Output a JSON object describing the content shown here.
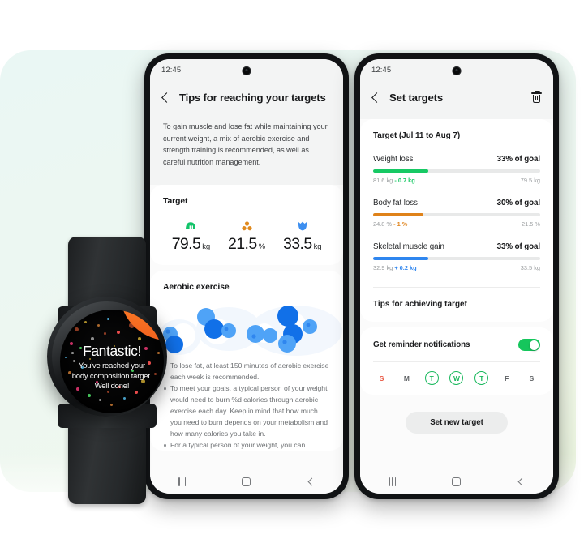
{
  "background": {
    "tint_left": "#eaf7f4",
    "tint_right": "#eff7e6"
  },
  "watch": {
    "headline": "Fantastic!",
    "line1": "You've reached your",
    "line2": "body composition target.",
    "line3": "Well done!"
  },
  "phone_tips": {
    "status_time": "12:45",
    "back_icon": "chevron-left-icon",
    "title": "Tips for reaching your targets",
    "intro": "To gain muscle and lose fat while maintaining your current weight, a mix of aerobic exercise and strength training is recommended, as well as careful nutrition management.",
    "target_card": {
      "title": "Target",
      "metrics": [
        {
          "icon": "weight-scale-icon",
          "color": "#12c46a",
          "value": "79.5",
          "unit": "kg"
        },
        {
          "icon": "body-fat-icon",
          "color": "#e08a1e",
          "value": "21.5",
          "unit": "%"
        },
        {
          "icon": "muscle-icon",
          "color": "#3d8ff0",
          "value": "33.5",
          "unit": "kg"
        }
      ]
    },
    "aerobic_card": {
      "title": "Aerobic exercise",
      "bullets": [
        "To lose fat, at least 150 minutes of aerobic exercise each week is recommended.",
        "To meet your goals, a typical person of your weight would need to burn %d calories through aerobic exercise each day. Keep in mind that how much you need to burn depends on your metabolism and how many calories you take in.",
        "For a typical person of your weight, you can"
      ]
    },
    "navbar": {
      "recent": "recent-apps-icon",
      "home": "home-icon",
      "back": "back-icon"
    }
  },
  "phone_targets": {
    "status_time": "12:45",
    "back_icon": "chevron-left-icon",
    "title": "Set targets",
    "delete_icon": "trash-icon",
    "target_header": "Target (Jul 11 to Aug 7)",
    "goals": [
      {
        "name": "Weight loss",
        "percent_label": "33% of goal",
        "percent": 33,
        "color": "#17c964",
        "start": "81.6 kg",
        "delta": "- 0.7 kg",
        "end": "79.5 kg"
      },
      {
        "name": "Body fat loss",
        "percent_label": "30% of goal",
        "percent": 30,
        "color": "#df8219",
        "start": "24.8 %",
        "delta": "- 1 %",
        "end": "21.5 %"
      },
      {
        "name": "Skeletal muscle gain",
        "percent_label": "33% of goal",
        "percent": 33,
        "color": "#2f86ef",
        "start": "32.9 kg",
        "delta": "+ 0.2 kg",
        "end": "33.5 kg"
      }
    ],
    "tips_row": "Tips for achieving target",
    "reminder": {
      "label": "Get reminder notifications",
      "enabled": true,
      "toggle_color": "#15c65c"
    },
    "days": [
      {
        "letter": "S",
        "selected": false,
        "sunday": true
      },
      {
        "letter": "M",
        "selected": false,
        "sunday": false
      },
      {
        "letter": "T",
        "selected": true,
        "sunday": false
      },
      {
        "letter": "W",
        "selected": true,
        "sunday": false
      },
      {
        "letter": "T",
        "selected": true,
        "sunday": false
      },
      {
        "letter": "F",
        "selected": false,
        "sunday": false
      },
      {
        "letter": "S",
        "selected": false,
        "sunday": false
      }
    ],
    "cta_label": "Set new target",
    "navbar": {
      "recent": "recent-apps-icon",
      "home": "home-icon",
      "back": "back-icon"
    }
  }
}
